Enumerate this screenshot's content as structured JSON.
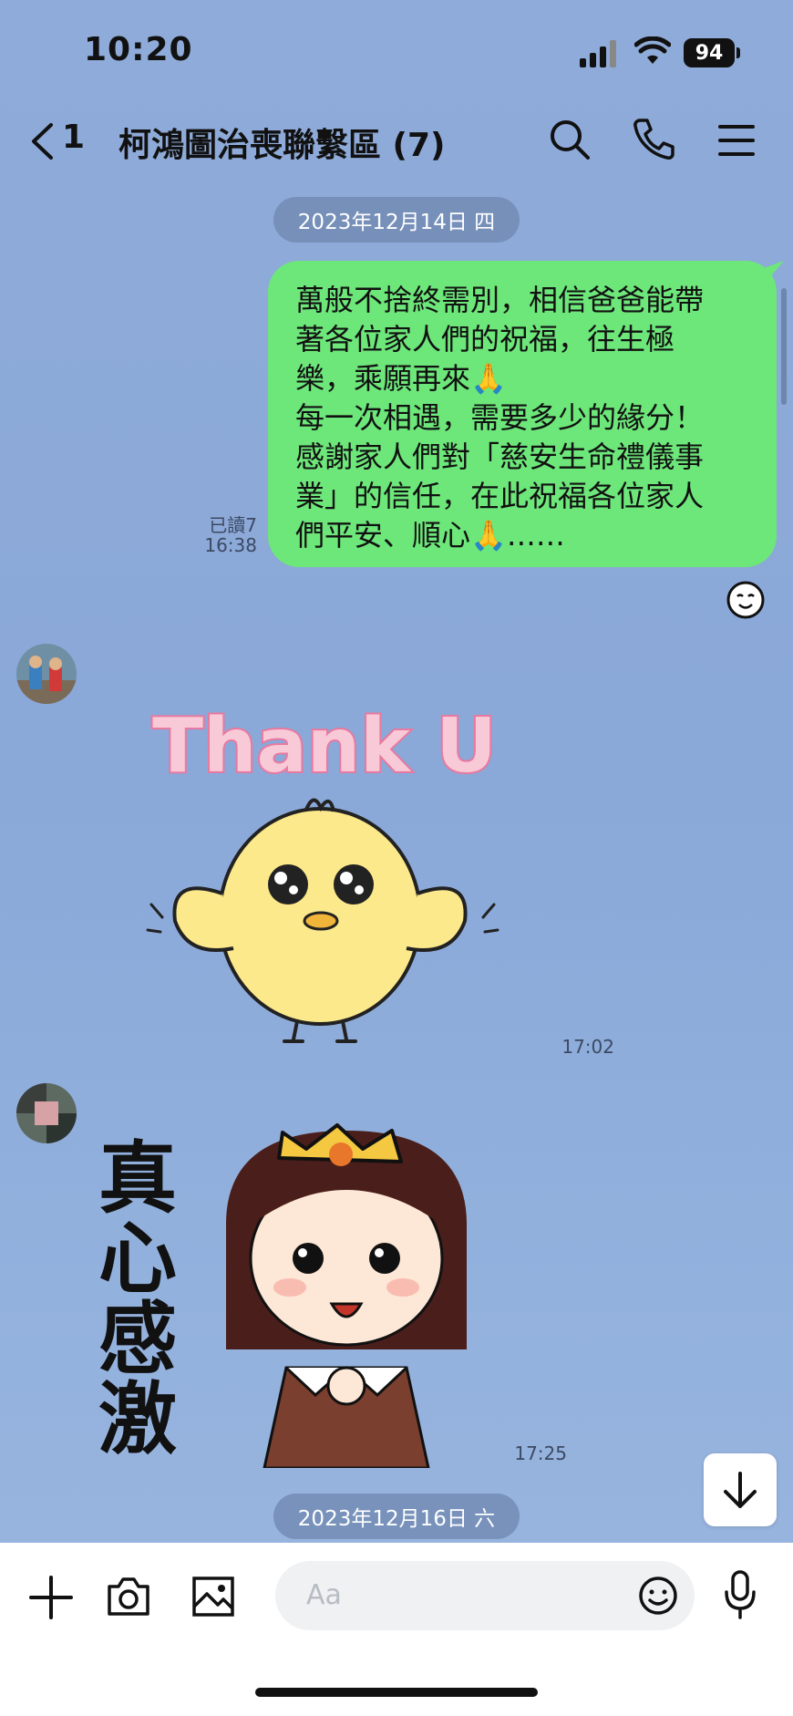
{
  "status_bar": {
    "time": "10:20",
    "battery": "94"
  },
  "header": {
    "back_count": "1",
    "title": "柯鴻圖治喪聯繫區 (7)"
  },
  "chat": {
    "date_1": "2023年12月14日 四",
    "date_2": "2023年12月16日 六",
    "outgoing": {
      "lines": [
        "萬般不捨終需別，相信爸爸能帶",
        "著各位家人們的祝福，往生極",
        "樂，乘願再來🙏",
        "每一次相遇，需要多少的緣分！",
        "感謝家人們對「慈安生命禮儀事",
        "業」的信任，在此祝福各位家人",
        "們平安、順心🙏……"
      ],
      "read_status": "已讀7",
      "time": "16:38"
    },
    "sticker_1": {
      "text": "Thank U",
      "time": "17:02"
    },
    "sticker_2": {
      "text": "真心感激",
      "time": "17:25"
    }
  },
  "input": {
    "placeholder": "Aa"
  },
  "colors": {
    "bubble": "#6de67a",
    "background": "#8aa8d8",
    "pill": "#6e87af"
  },
  "icons": [
    "back-chevron-icon",
    "search-icon",
    "phone-icon",
    "menu-icon",
    "plus-icon",
    "camera-icon",
    "image-icon",
    "emoji-icon",
    "mic-icon",
    "arrow-down-icon",
    "reaction-face-icon"
  ]
}
